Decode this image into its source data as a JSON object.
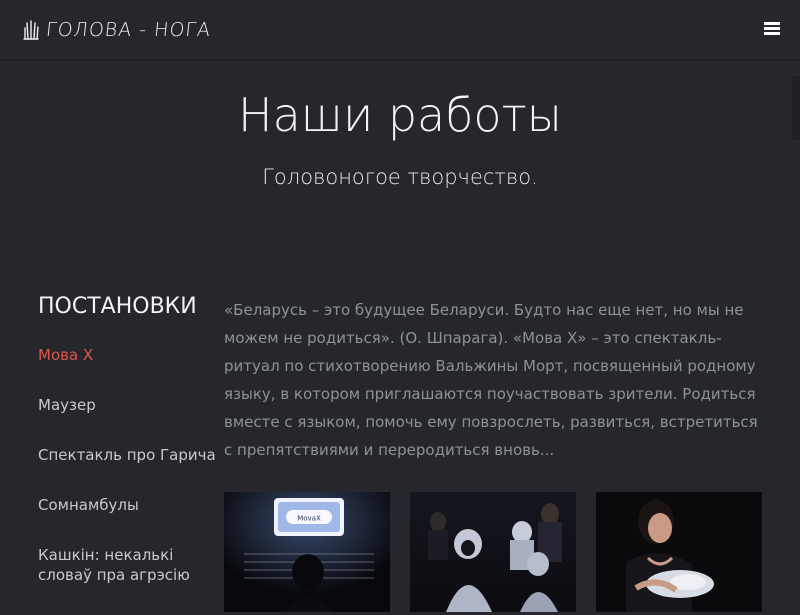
{
  "header": {
    "logo_text": "ГОЛОВА - НОГА",
    "logo_icon": "hand-logo-icon",
    "menu_icon": "hamburger-menu-icon"
  },
  "hero": {
    "title": "Наши работы",
    "subtitle": "Головоногое творчество."
  },
  "sidebar": {
    "heading": "ПОСТАНОВКИ",
    "items": [
      {
        "label": "Мова X",
        "active": true
      },
      {
        "label": "Маузер",
        "active": false
      },
      {
        "label": "Спектакль про Гарича",
        "active": false
      },
      {
        "label": "Сомнамбулы",
        "active": false
      },
      {
        "label": "Кашкін: некалькі словаў пра агрэсію",
        "active": false
      }
    ]
  },
  "description": "«Беларусь – это будущее Беларуси. Будто нас еще нет, но мы не можем не родиться». (О. Шпарага). «Мова Х» – это спектакль-ритуал по стихотворению Вальжины Морт, посвященный родному языку, в котором приглашаются поучаствовать зрители. Родиться вместе с языком, помочь ему повзрослеть, развиться, встретиться с препятствиями и переродиться вновь...",
  "gallery": {
    "images": [
      {
        "name": "photo-lightbox-performer",
        "sign_text": "MovaX"
      },
      {
        "name": "photo-hooded-audience"
      },
      {
        "name": "photo-actress-with-bundle"
      }
    ]
  },
  "colors": {
    "background": "#25272c",
    "accent": "#e0544f",
    "text_muted": "#8e9196"
  }
}
